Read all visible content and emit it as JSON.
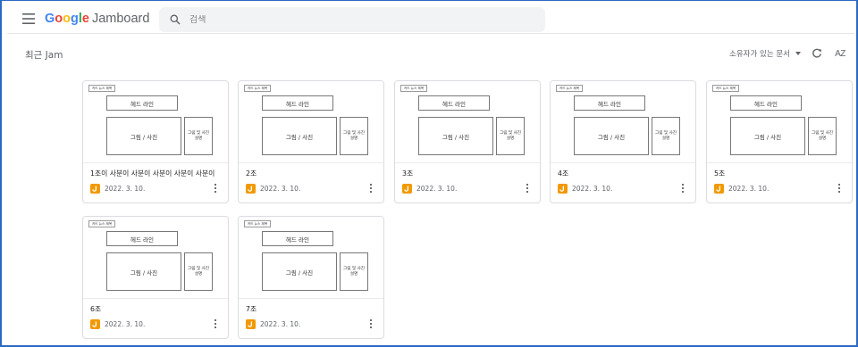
{
  "header": {
    "logo_text": "Google",
    "product_name": "Jamboard",
    "search_placeholder": "검색"
  },
  "section_title": "최근 Jam",
  "controls": {
    "owner_filter": "소유자가 있는 문서",
    "sort_label": "AZ"
  },
  "template": {
    "tag": "카드 뉴스 제목",
    "headline": "헤드 라인",
    "photo": "그림 / 사진",
    "caption": "그림 및 사진 설명"
  },
  "jams": [
    {
      "title": "1조이 사분이 사분이 사분이 사분이 사분이",
      "date": "2022. 3. 10."
    },
    {
      "title": "2조",
      "date": "2022. 3. 10."
    },
    {
      "title": "3조",
      "date": "2022. 3. 10."
    },
    {
      "title": "4조",
      "date": "2022. 3. 10."
    },
    {
      "title": "5조",
      "date": "2022. 3. 10."
    },
    {
      "title": "6조",
      "date": "2022. 3. 10."
    },
    {
      "title": "7조",
      "date": "2022. 3. 10."
    }
  ],
  "colors": {
    "jam_icon": "#f29900",
    "frame_border": "#2c68c4",
    "google_blue": "#4285f4",
    "google_red": "#ea4335",
    "google_yellow": "#fbbc05",
    "google_green": "#34a853"
  }
}
